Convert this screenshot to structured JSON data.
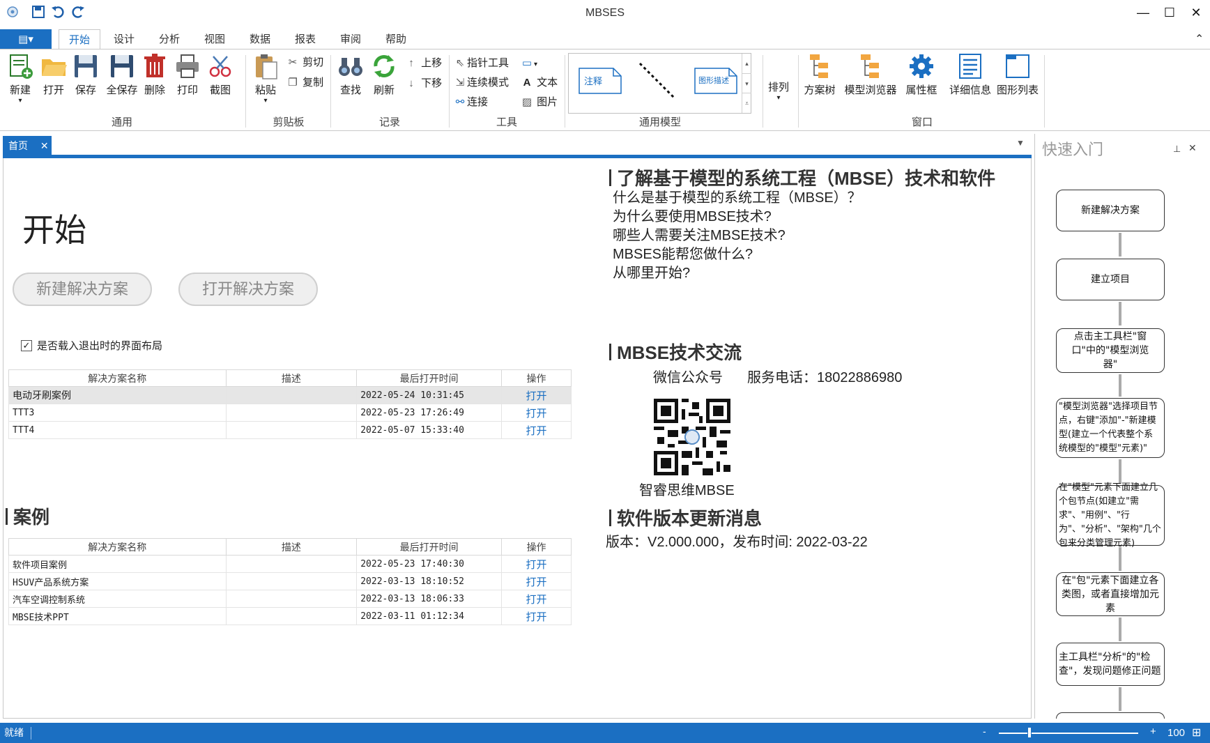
{
  "window": {
    "title": "MBSES"
  },
  "menu": {
    "file_icon": "file-menu-icon",
    "items": [
      "开始",
      "设计",
      "分析",
      "视图",
      "数据",
      "报表",
      "审阅",
      "帮助"
    ]
  },
  "ribbon": {
    "groups": {
      "general": "通用",
      "clipboard": "剪贴板",
      "record": "记录",
      "tools": "工具",
      "model": "通用模型",
      "window": "窗口"
    },
    "general_buttons": [
      "新建",
      "打开",
      "保存",
      "全保存",
      "删除",
      "打印",
      "截图"
    ],
    "clipboard": {
      "paste": "粘贴",
      "cut": "剪切",
      "copy": "复制"
    },
    "record": {
      "find": "查找",
      "refresh": "刷新",
      "up": "上移",
      "down": "下移"
    },
    "tools": {
      "pointer": "指针工具",
      "continuous": "连续模式",
      "connect": "连接",
      "text": "文本",
      "image": "图片"
    },
    "gallery": {
      "note": "注释",
      "shape_desc": "图形描述"
    },
    "arrange": "排列",
    "window_buttons": [
      "方案树",
      "模型浏览器",
      "属性框",
      "详细信息",
      "图形列表"
    ]
  },
  "doc_tab": {
    "label": "首页"
  },
  "start": {
    "title": "开始",
    "new_solution": "新建解决方案",
    "open_solution": "打开解决方案",
    "load_layout_label": "是否载入退出时的界面布局",
    "load_layout_checked": true
  },
  "recent": {
    "columns": [
      "解决方案名称",
      "描述",
      "最后打开时间",
      "操作"
    ],
    "rows": [
      {
        "name": "电动牙刷案例",
        "desc": "",
        "time": "2022-05-24 10:31:45",
        "op": "打开"
      },
      {
        "name": "TTT3",
        "desc": "",
        "time": "2022-05-23 17:26:49",
        "op": "打开"
      },
      {
        "name": "TTT4",
        "desc": "",
        "time": "2022-05-07 15:33:40",
        "op": "打开"
      }
    ]
  },
  "cases": {
    "title": "案例",
    "columns": [
      "解决方案名称",
      "描述",
      "最后打开时间",
      "操作"
    ],
    "rows": [
      {
        "name": "软件项目案例",
        "desc": "",
        "time": "2022-05-23 17:40:30",
        "op": "打开"
      },
      {
        "name": "HSUV产品系统方案",
        "desc": "",
        "time": "2022-03-13 18:10:52",
        "op": "打开"
      },
      {
        "name": "汽车空调控制系统",
        "desc": "",
        "time": "2022-03-13 18:06:33",
        "op": "打开"
      },
      {
        "name": "MBSE技术PPT",
        "desc": "",
        "time": "2022-03-11 01:12:34",
        "op": "打开"
      }
    ]
  },
  "learn": {
    "title": "了解基于模型的系统工程（MBSE）技术和软件",
    "items": [
      "什么是基于模型的系统工程（MBSE）？",
      "为什么要使用MBSE技术?",
      "哪些人需要关注MBSE技术?",
      "MBSES能帮您做什么?",
      "从哪里开始?"
    ]
  },
  "exchange": {
    "title": "MBSE技术交流",
    "wechat": "微信公众号",
    "phone": "服务电话：18022886980",
    "qr_caption": "智睿思维MBSE"
  },
  "version": {
    "title": "软件版本更新消息",
    "text": "版本：V2.000.000，发布时间: 2022-03-22"
  },
  "quickstart": {
    "title": "快速入门",
    "steps": [
      "新建解决方案",
      "建立项目",
      "点击主工具栏\"窗口\"中的\"模型浏览器\"",
      "\"模型浏览器\"选择项目节点，右键\"添加\"-\"新建模型(建立一个代表整个系统模型的\"模型\"元素)\"",
      "在\"模型\"元素下面建立几个包节点(如建立\"需求\"、\"用例\"、\"行为\"、\"分析\"、\"架构\"几个包来分类管理元素)",
      "在\"包\"元素下面建立各类图，或者直接增加元素",
      "主工具栏\"分析\"的\"检查\"，发现问题修正问题"
    ]
  },
  "status": {
    "text": "就绪",
    "zoom_minus": "-",
    "zoom_plus": "+",
    "zoom": "100",
    "zoom_level": 0.22
  }
}
